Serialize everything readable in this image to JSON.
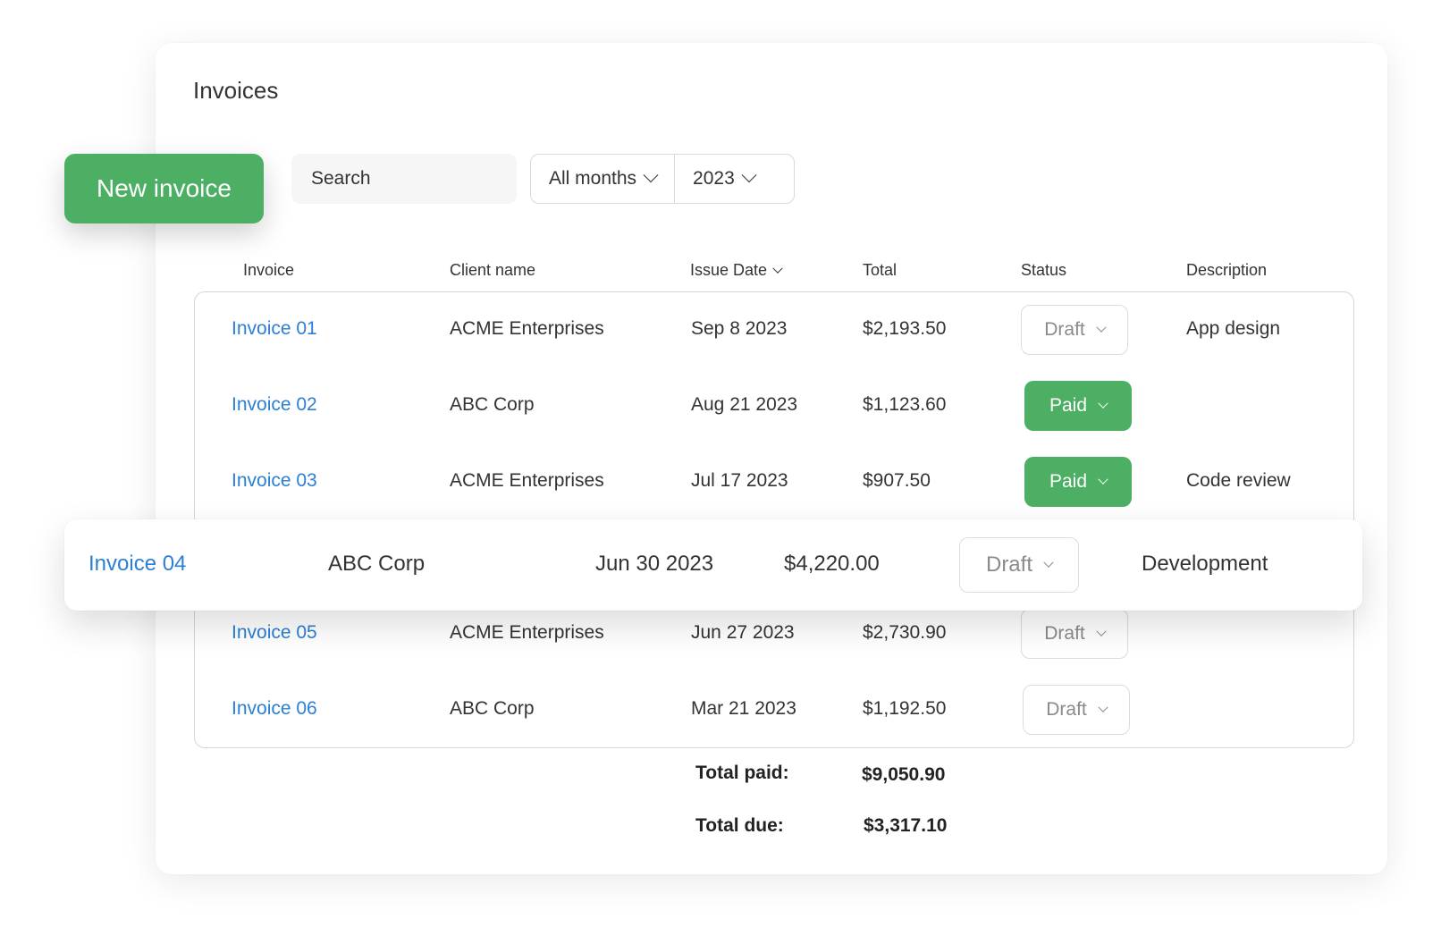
{
  "page": {
    "title": "Invoices"
  },
  "toolbar": {
    "new_invoice_label": "New invoice",
    "search_placeholder": "Search",
    "month_filter": "All months",
    "year_filter": "2023"
  },
  "table": {
    "headers": {
      "invoice": "Invoice",
      "client": "Client name",
      "issue_date": "Issue Date",
      "total": "Total",
      "status": "Status",
      "description": "Description"
    },
    "rows": [
      {
        "invoice": "Invoice 01",
        "client": "ACME Enterprises",
        "date": "Sep 8 2023",
        "total": "$2,193.50",
        "status": "Draft",
        "description": "App design"
      },
      {
        "invoice": "Invoice 02",
        "client": "ABC Corp",
        "date": "Aug 21 2023",
        "total": "$1,123.60",
        "status": "Paid",
        "description": ""
      },
      {
        "invoice": "Invoice 03",
        "client": "ACME Enterprises",
        "date": "Jul 17 2023",
        "total": "$907.50",
        "status": "Paid",
        "description": "Code review"
      },
      {
        "invoice": "Invoice 04",
        "client": "ABC Corp",
        "date": "Jun 30 2023",
        "total": "$4,220.00",
        "status": "Draft",
        "description": "Development"
      },
      {
        "invoice": "Invoice 05",
        "client": "ACME Enterprises",
        "date": "Jun 27 2023",
        "total": "$2,730.90",
        "status": "Draft",
        "description": ""
      },
      {
        "invoice": "Invoice 06",
        "client": "ABC Corp",
        "date": "Mar 21 2023",
        "total": "$1,192.50",
        "status": "Draft",
        "description": ""
      }
    ]
  },
  "totals": {
    "paid_label": "Total paid:",
    "paid_value": "$9,050.90",
    "due_label": "Total due:",
    "due_value": "$3,317.10"
  },
  "colors": {
    "accent_green": "#4caf63",
    "link_blue": "#2b7fd4"
  }
}
